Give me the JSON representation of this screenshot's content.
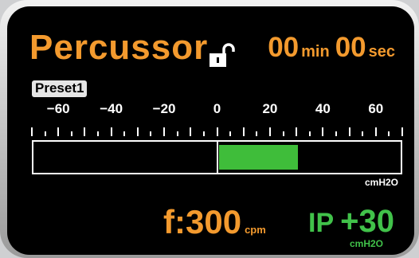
{
  "header": {
    "title": "Percussor",
    "lock_icon": "unlocked-padlock-icon",
    "timer": {
      "minutes": "00",
      "minutes_unit": "min",
      "seconds": "00",
      "seconds_unit": "sec"
    }
  },
  "preset": {
    "label": "Preset1"
  },
  "scale": {
    "min": -70,
    "max": 70,
    "labels": [
      "−60",
      "−40",
      "−20",
      "0",
      "20",
      "40",
      "60"
    ],
    "label_values": [
      -60,
      -40,
      -20,
      0,
      20,
      40,
      60
    ],
    "unit": "cmH2O"
  },
  "pressure_bar": {
    "start_value": 0,
    "end_value": 30,
    "fill_color": "#3fbd3a"
  },
  "frequency": {
    "label": "f:300",
    "unit": "cpm"
  },
  "ip": {
    "label": "IP",
    "value": "+30",
    "unit": "cmH2O"
  },
  "colors": {
    "accent_orange": "#f39a2e",
    "accent_green": "#41c24a",
    "background": "#000000"
  }
}
